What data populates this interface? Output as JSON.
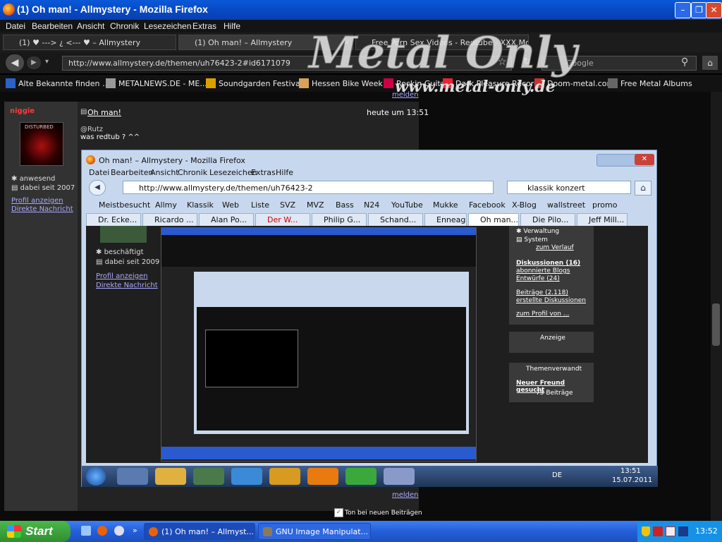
{
  "window": {
    "title": "(1) Oh man! - Allmystery - Mozilla Firefox"
  },
  "menu": [
    "Datei",
    "Bearbeiten",
    "Ansicht",
    "Chronik",
    "Lesezeichen",
    "Extras",
    "Hilfe"
  ],
  "tabs": [
    {
      "label": "(1) ♥ ---> ¿ <--- ♥ – Allmystery"
    },
    {
      "label": "(1) Oh man! – Allmystery"
    },
    {
      "label": "Free Porn Sex Videos - Redtube - XXX Mo..."
    }
  ],
  "nav": {
    "url": "http://www.allmystery.de/themen/uh76423-2#id6171079",
    "search_placeholder": "Google"
  },
  "bookmarks": [
    "Alte Bekannte finden ...",
    "METALNEWS.DE - ME...",
    "Soundgarden Festival",
    "Hessen Bike Week",
    "Rockin Guitar",
    "Dark Pleasure Record",
    "Doom-metal.com",
    "Free Metal Albums"
  ],
  "logo": {
    "text": "Metal Only",
    "sub": "www.metal-only.de"
  },
  "post": {
    "meldenTop": "melden",
    "username": "niggie",
    "title": "Oh man!",
    "time": "heute um 13:51",
    "quote": "@Rutz",
    "text": "was redtub ? ^^",
    "status": "anwesend",
    "since": "dabei seit 2007",
    "profile": "Profil anzeigen",
    "message": "Direkte Nachricht",
    "meldenBottom": "melden",
    "sound": "Ton bei neuen Beiträgen"
  },
  "inner": {
    "title": "Oh man! – Allmystery - Mozilla Firefox",
    "menu": [
      "Datei",
      "Bearbeiten",
      "Ansicht",
      "Chronik",
      "Lesezeichen",
      "Extras",
      "Hilfe"
    ],
    "url": "http://www.allmystery.de/themen/uh76423-2",
    "search": "klassik konzert",
    "bookmarks": [
      "Meistbesucht",
      "Allmy",
      "Klassik",
      "Web",
      "Liste",
      "SVZ",
      "MVZ",
      "Bass",
      "N24",
      "YouTube",
      "Mukke",
      "Facebook",
      "X-Blog",
      "wallstreet",
      "promo"
    ],
    "tabs": [
      "Dr. Ecke...",
      "Ricardo ...",
      "Alan Po...",
      "Der W...",
      "Philip G...",
      "Schand...",
      "Enneagr...",
      "Oh man...",
      "Die Pilo...",
      "Jeff Mill..."
    ],
    "profile": {
      "status": "beschäftigt",
      "since": "dabei seit 2009",
      "profile": "Profil anzeigen",
      "message": "Direkte Nachricht"
    },
    "sidebar": {
      "admin": "Verwaltung",
      "system": "System",
      "history": "zum Verlauf",
      "discussions": "Diskussionen (16)",
      "blogs": "abonnierte Blogs",
      "drafts": "Entwürfe (24)",
      "posts": "Beiträge (2.118)",
      "created": "erstellte Diskussionen",
      "toProfile": "zum Profil von ...",
      "ad": "Anzeige",
      "related": "Themenverwandt",
      "relTitle": "Neuer Freund gesucht",
      "relCount": "75 Beiträge"
    },
    "tray": {
      "lang": "DE",
      "time": "13:51",
      "date": "15.07.2011"
    }
  },
  "taskbar": {
    "start": "Start",
    "tasks": [
      "(1) Oh man! – Allmyst...",
      "GNU Image Manipulat..."
    ],
    "clock": "13:52"
  },
  "colors": {
    "titlebar": "#0a58d8",
    "taskbar": "#245fd9",
    "start": "#3ea63e",
    "username": "#ff3b3b",
    "link": "#aaaaff"
  }
}
